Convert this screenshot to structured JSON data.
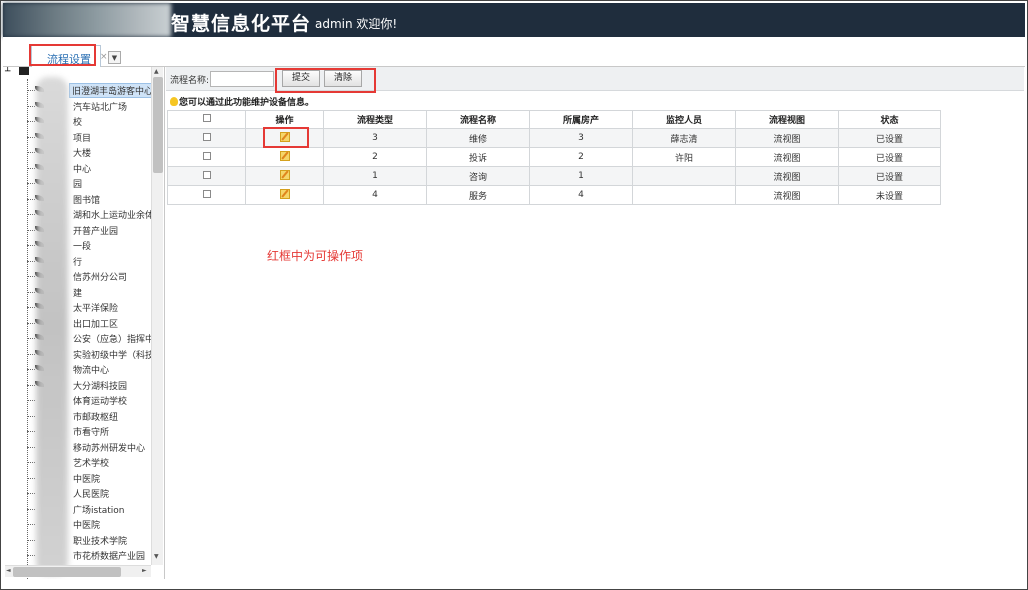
{
  "header": {
    "title": "智慧信息化平台",
    "welcome": "admin 欢迎你!"
  },
  "tabs": {
    "active_label": "流程设置",
    "close_glyph": "×",
    "menu_glyph": "▼"
  },
  "tree": {
    "items": [
      "旧澄湖丰岛游客中心",
      "汽车站北广场",
      "校",
      "项目",
      "大楼",
      "中心",
      "园",
      "图书馆",
      "湖和水上运动业余体",
      "开普产业园",
      "一段",
      "行",
      "信苏州分公司",
      "建",
      "太平洋保险",
      "出口加工区",
      "公安（应急）指挥中心",
      "实验初级中学（科技城",
      "物流中心",
      "大分湖科技园",
      "体育运动学校",
      "市邮政枢纽",
      "市看守所",
      "移动苏州研发中心",
      "艺术学校",
      "中医院",
      "人民医院",
      "广场istation",
      "中医院",
      "职业技术学院",
      "市花桥数据产业园"
    ],
    "scroll_up": "▲",
    "scroll_down": "▼",
    "scroll_left": "◄",
    "scroll_right": "►"
  },
  "search": {
    "label": "流程名称:",
    "value": "",
    "submit_label": "提交",
    "clear_label": "清除"
  },
  "hint": "您可以通过此功能维护设备信息。",
  "table": {
    "headers": [
      "",
      "操作",
      "流程类型",
      "流程名称",
      "所属房产",
      "监控人员",
      "流程视图",
      "状态"
    ],
    "rows": [
      {
        "type": "3",
        "name": "维修",
        "property": "3",
        "monitor": "薛志清",
        "view": "流视图",
        "status": "已设置"
      },
      {
        "type": "2",
        "name": "投诉",
        "property": "2",
        "monitor": "许阳",
        "view": "流视图",
        "status": "已设置"
      },
      {
        "type": "1",
        "name": "咨询",
        "property": "1",
        "monitor": "",
        "view": "流视图",
        "status": "已设置"
      },
      {
        "type": "4",
        "name": "服务",
        "property": "4",
        "monitor": "",
        "view": "流视图",
        "status": "未设置"
      }
    ]
  },
  "annotation": "红框中为可操作项",
  "colors": {
    "header_bg": "#1f2d3d",
    "annotation_red": "#e53935",
    "link_blue": "#2a6fb3"
  }
}
